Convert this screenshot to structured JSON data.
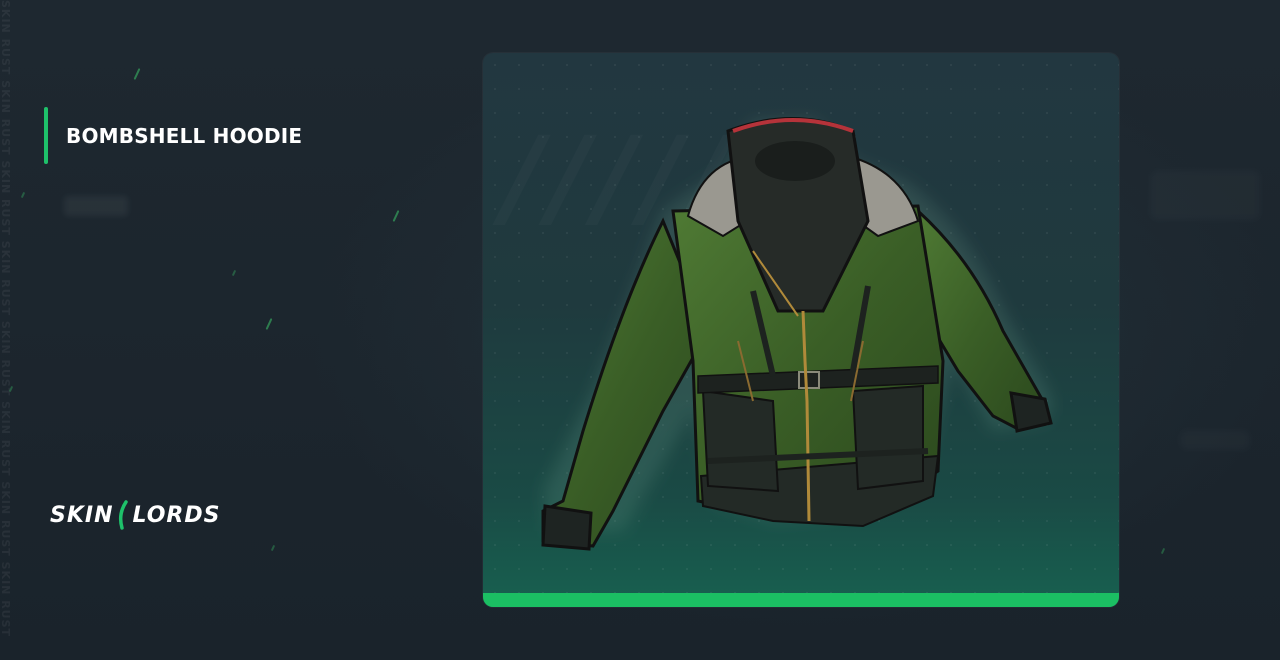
{
  "item": {
    "name": "BOMBSHELL HOODIE"
  },
  "brand": {
    "logo_left": "SKIN",
    "logo_right": "LORDS",
    "side_watermark": "SKIN RUST SKIN RUST SKIN RUST SKIN RUST SKIN RUST SKIN RUST SKIN RUST SKIN RUST"
  },
  "colors": {
    "accent": "#1ec16a",
    "background": "#1c252e",
    "card_bottom_bar": "#1bbf63"
  },
  "icons": {
    "item": "jacket-icon"
  }
}
